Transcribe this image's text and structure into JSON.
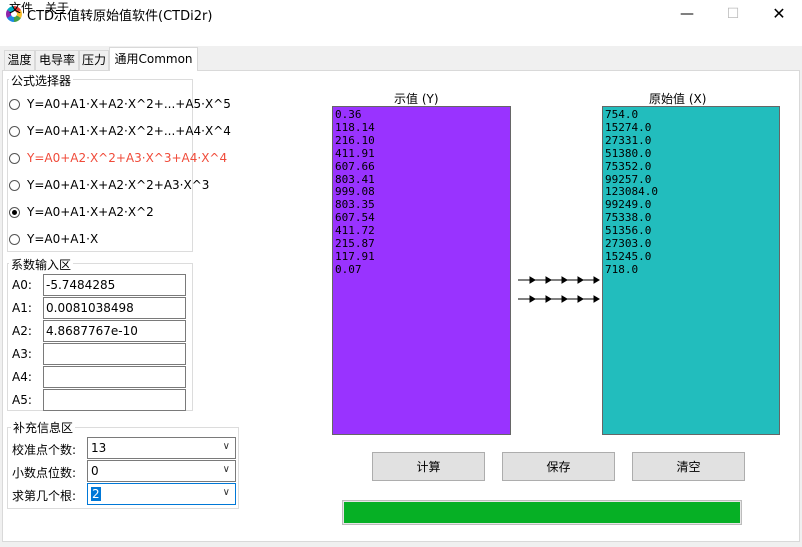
{
  "window": {
    "title": "CTD示值转原始值软件(CTDi2r)",
    "minimize_glyph": "—",
    "maximize_glyph": "☐",
    "close_glyph": "✕"
  },
  "menu": {
    "file": "文件",
    "about": "关于"
  },
  "tabs": [
    {
      "label": "温度"
    },
    {
      "label": "电导率"
    },
    {
      "label": "压力"
    },
    {
      "label": "通用Common",
      "active": true
    }
  ],
  "formula_group": {
    "title": "公式选择器",
    "options": [
      {
        "label": "Y=A0+A1·X+A2·X^2+...+A5·X^5",
        "checked": false,
        "highlight": false
      },
      {
        "label": "Y=A0+A1·X+A2·X^2+...+A4·X^4",
        "checked": false,
        "highlight": false
      },
      {
        "label": "Y=A0+A2·X^2+A3·X^3+A4·X^4",
        "checked": false,
        "highlight": true
      },
      {
        "label": "Y=A0+A1·X+A2·X^2+A3·X^3",
        "checked": false,
        "highlight": false
      },
      {
        "label": "Y=A0+A1·X+A2·X^2",
        "checked": true,
        "highlight": false
      },
      {
        "label": "Y=A0+A1·X",
        "checked": false,
        "highlight": false
      }
    ]
  },
  "coef_group": {
    "title": "系数输入区",
    "rows": [
      {
        "label": "A0:",
        "value": "-5.7484285"
      },
      {
        "label": "A1:",
        "value": "0.0081038498"
      },
      {
        "label": "A2:",
        "value": "4.8687767e-10"
      },
      {
        "label": "A3:",
        "value": ""
      },
      {
        "label": "A4:",
        "value": ""
      },
      {
        "label": "A5:",
        "value": ""
      }
    ]
  },
  "supp_group": {
    "title": "补充信息区",
    "rows": [
      {
        "label": "校准点个数:",
        "value": "13"
      },
      {
        "label": "小数点位数:",
        "value": "0"
      },
      {
        "label": "求第几个根:",
        "value": "2"
      }
    ]
  },
  "display_column": {
    "header": "示值 (Y)",
    "values": [
      "0.36",
      "118.14",
      "216.10",
      "411.91",
      "607.66",
      "803.41",
      "999.08",
      "803.35",
      "607.54",
      "411.72",
      "215.87",
      "117.91",
      "0.07"
    ]
  },
  "raw_column": {
    "header": "原始值 (X)",
    "values": [
      "754.0",
      "15274.0",
      "27331.0",
      "51380.0",
      "75352.0",
      "99257.0",
      "123084.0",
      "99249.0",
      "75338.0",
      "51356.0",
      "27303.0",
      "15245.0",
      "718.0"
    ]
  },
  "buttons": {
    "calculate": "计算",
    "save": "保存",
    "clear": "清空"
  },
  "progress": {
    "percent": 100
  },
  "colors": {
    "display_bg": "#9933ff",
    "raw_bg": "#22bdbd",
    "progress": "#06b025",
    "highlight_text": "#f04b3a"
  }
}
